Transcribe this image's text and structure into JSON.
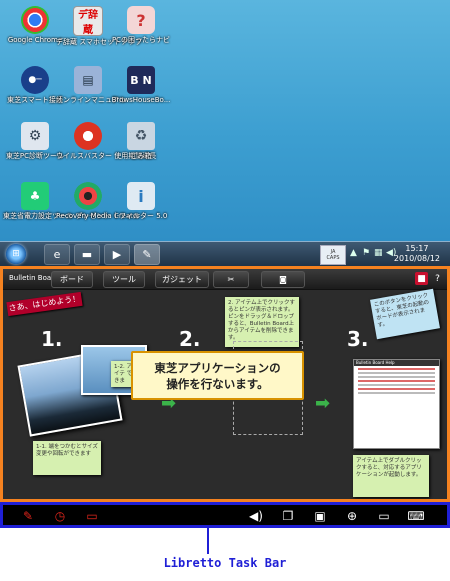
{
  "desktop": {
    "icons": [
      {
        "label": "Google Chrome",
        "glyph": "",
        "icon": "chrome-icon"
      },
      {
        "label": "デ辞蔵 スマホセットアップ",
        "glyph": "デ辞蔵",
        "icon": "dictionary-app-icon"
      },
      {
        "label": "PCの困ったらナビ",
        "glyph": "?",
        "icon": "help-guide-icon"
      },
      {
        "label": "東芝スマート接続",
        "glyph": "",
        "icon": "key-icon"
      },
      {
        "label": "オンラインマニュアル",
        "glyph": "",
        "icon": "manual-icon"
      },
      {
        "label": "BrowsHouseBo...",
        "glyph": "B N",
        "icon": "toshiba-bn-icon"
      },
      {
        "label": "東芝PC診断ツール",
        "glyph": "",
        "icon": "diagnostic-tool-icon"
      },
      {
        "label": "ウイルスバスター 使用期間延長",
        "glyph": "",
        "icon": "antivirus-icon"
      },
      {
        "label": "ごみ箱",
        "glyph": "",
        "icon": "recycle-bin-icon"
      },
      {
        "label": "東芝省電力設定ツール プレゼント",
        "glyph": "",
        "icon": "power-tool-icon"
      },
      {
        "label": "Recovery Media Creator",
        "glyph": "",
        "icon": "disc-icon"
      },
      {
        "label": "i-フィルター 5.0",
        "glyph": "i",
        "icon": "i-filter-icon"
      }
    ]
  },
  "taskbar": {
    "ime_line1": "JA",
    "ime_line2": "CAPS",
    "time": "15:17",
    "date": "2010/08/12"
  },
  "bulletin": {
    "title": "Bulletin Board",
    "menu_board": "ボード",
    "menu_tool": "ツール",
    "menu_gadget": "ガジェット",
    "help": "?",
    "banner": "さあ、はじめよう！",
    "step1": "1.",
    "step2": "2.",
    "step3": "3.",
    "note_step2": "2. アイテム上でクリックするとピンが表示されます。ピンをドラッグ＆ドロップすると、Bulletin Board上からアイテムを削除できます。",
    "note_resize": "1-1. 端をつかむとサイズ変更や回転ができます",
    "note_1_2": "1-2. アイテ できま",
    "note_blue": "このボタンをクリックすると、東芝の起動のボードが表示されます。",
    "note_step3": "アイテム上でダブルクリックすると、対応するアプリケーションが起動します。",
    "card_title": "Bulletin Board Help",
    "callout_line1": "東芝アプリケーションの",
    "callout_line2": "操作を行ないます。"
  },
  "libretto": {
    "caption": "Libretto Task Bar"
  },
  "colors": {
    "frame_orange": "#f58220",
    "taskbar_border_blue": "#1f1fd6",
    "banner_red": "#b1002a"
  }
}
